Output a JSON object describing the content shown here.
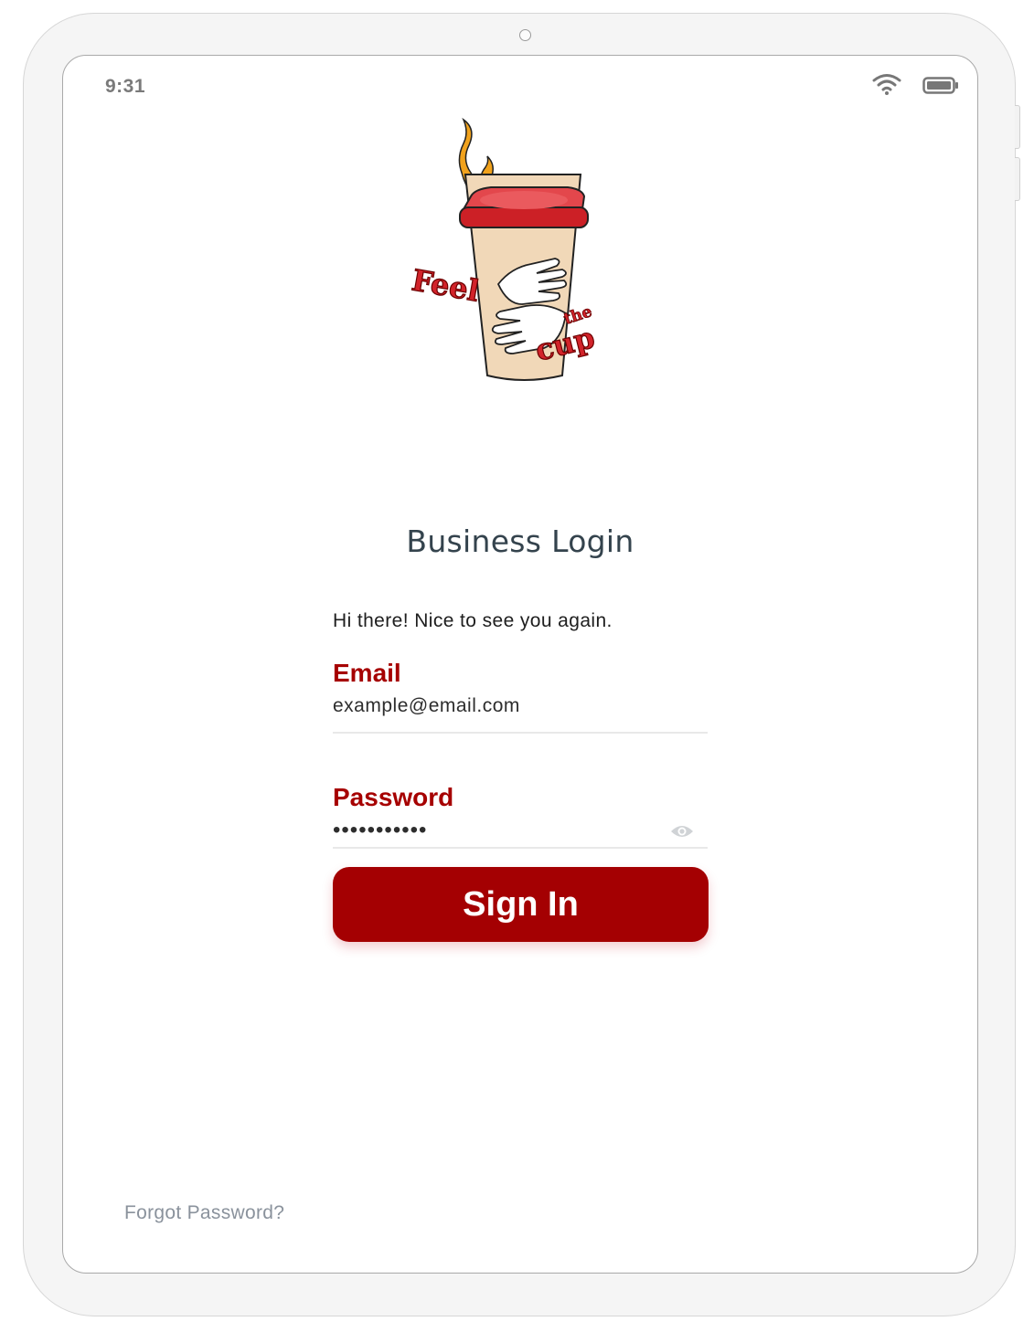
{
  "status_bar": {
    "time": "9:31",
    "wifi_icon": "wifi-icon",
    "battery_icon": "battery-icon"
  },
  "brand": {
    "logo_text_1": "Feel",
    "logo_text_2": "the",
    "logo_text_3": "cup"
  },
  "login": {
    "title": "Business Login",
    "greeting": "Hi there! Nice to see you again.",
    "email_label": "Email",
    "email_value": "example@email.com",
    "password_label": "Password",
    "password_value": "•••••••••••",
    "show_password_icon": "eye-icon",
    "sign_in_label": "Sign In",
    "forgot_password": "Forgot Password?"
  },
  "colors": {
    "accent": "#a40002",
    "title": "#34434d",
    "link": "#8a929c"
  }
}
